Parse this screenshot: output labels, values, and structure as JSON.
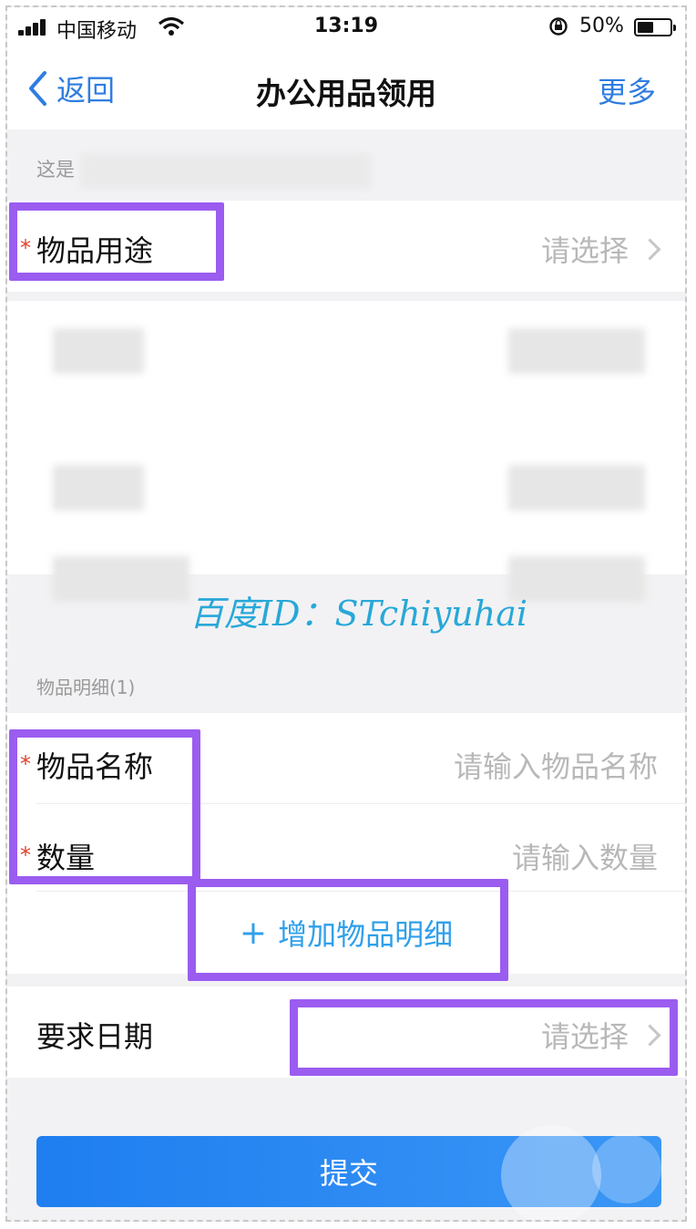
{
  "status_bar": {
    "carrier": "中国移动",
    "time": "13:19",
    "battery": "50%",
    "icons": [
      "signal-icon",
      "wifi-icon",
      "orientation-lock-icon",
      "battery-icon"
    ]
  },
  "nav": {
    "back_label": "返回",
    "title": "办公用品领用",
    "more_label": "更多"
  },
  "hint_text": "这是",
  "fields": {
    "purpose": {
      "label": "物品用途",
      "value": "请选择",
      "required_mark": "*"
    }
  },
  "detail_section": {
    "title": "物品明细(1)",
    "name_label": "物品名称",
    "name_placeholder": "请输入物品名称",
    "qty_label": "数量",
    "qty_placeholder": "请输入数量",
    "required_mark": "*",
    "add_plus": "+",
    "add_label": "增加物品明细"
  },
  "date_field": {
    "label": "要求日期",
    "value": "请选择"
  },
  "watermark": "百度ID：STchiyuhai",
  "submit_label": "提交",
  "colors": {
    "accent": "#2f7de1",
    "highlight": "#9b5cf0",
    "required": "#e2402a",
    "submit": "#1f7ef0"
  }
}
